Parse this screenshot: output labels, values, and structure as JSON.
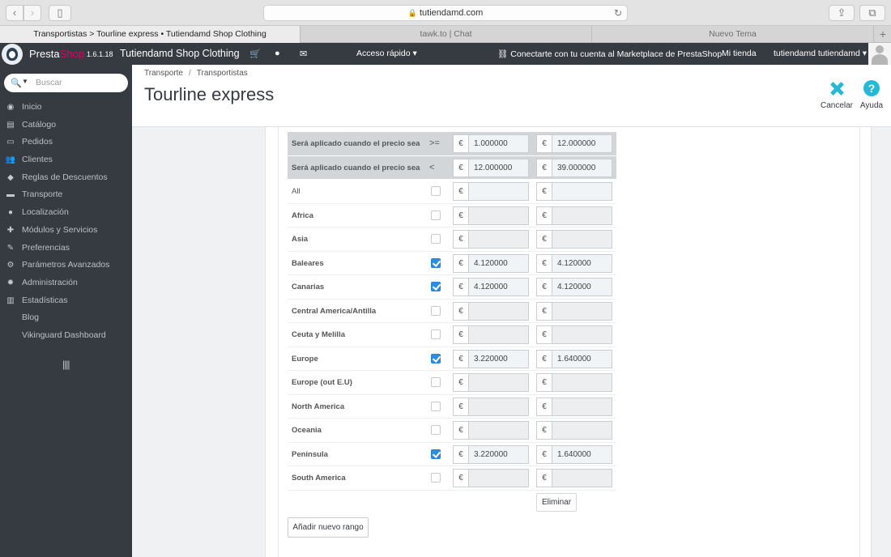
{
  "browser": {
    "url": "tutiendamd.com",
    "tabs": [
      {
        "label": "Transportistas > Tourline express • Tutiendamd Shop Clothing",
        "active": true
      },
      {
        "label": "tawk.to | Chat",
        "active": false
      },
      {
        "label": "Nuevo Tema",
        "active": false
      }
    ]
  },
  "header": {
    "brand_presta": "Presta",
    "brand_shop": "Shop",
    "version": "1.6.1.18",
    "shop_name": "Tutiendamd Shop Clothing",
    "quick_access": "Acceso rápido ▾",
    "marketplace": "Conectarte con tu cuenta al Marketplace de PrestaShop",
    "my_shop": "Mi tienda",
    "user": "tutiendamd tutiendamd ▾"
  },
  "sidebar": {
    "search_placeholder": "Buscar",
    "items": [
      {
        "label": "Inicio",
        "icon": "dashboard-icon",
        "glyph": "◉"
      },
      {
        "label": "Catálogo",
        "icon": "catalog-icon",
        "glyph": "▤"
      },
      {
        "label": "Pedidos",
        "icon": "orders-icon",
        "glyph": "▭"
      },
      {
        "label": "Clientes",
        "icon": "customers-icon",
        "glyph": "👥"
      },
      {
        "label": "Reglas de Descuentos",
        "icon": "tag-icon",
        "glyph": "◆"
      },
      {
        "label": "Transporte",
        "icon": "truck-icon",
        "glyph": "▬"
      },
      {
        "label": "Localización",
        "icon": "globe-icon",
        "glyph": "●"
      },
      {
        "label": "Módulos y Servicios",
        "icon": "puzzle-icon",
        "glyph": "✚"
      },
      {
        "label": "Preferencias",
        "icon": "wrench-icon",
        "glyph": "✎"
      },
      {
        "label": "Parámetros Avanzados",
        "icon": "cogs-icon",
        "glyph": "⚙"
      },
      {
        "label": "Administración",
        "icon": "cog-icon",
        "glyph": "✹"
      },
      {
        "label": "Estadísticas",
        "icon": "bar-chart-icon",
        "glyph": "▥"
      },
      {
        "label": "Blog",
        "icon": "",
        "glyph": ""
      },
      {
        "label": "Vikinguard Dashboard",
        "icon": "",
        "glyph": ""
      }
    ]
  },
  "page": {
    "breadcrumb": [
      "Transporte",
      "Transportistas"
    ],
    "title": "Tourline express",
    "cancel_label": "Cancelar",
    "help_label": "Ayuda"
  },
  "ranges": {
    "header_rows": [
      {
        "label": "Será aplicado cuando el precio sea",
        "operator": ">=",
        "from": "1.000000",
        "to": "12.000000"
      },
      {
        "label": "Será aplicado cuando el precio sea",
        "operator": "<",
        "from": "12.000000",
        "to": "39.000000"
      }
    ],
    "currency": "€",
    "zones": [
      {
        "name": "All",
        "checked": false,
        "v1": "",
        "v2": "",
        "plain": true
      },
      {
        "name": "Africa",
        "checked": false,
        "v1": "",
        "v2": ""
      },
      {
        "name": "Asia",
        "checked": false,
        "v1": "",
        "v2": ""
      },
      {
        "name": "Baleares",
        "checked": true,
        "v1": "4.120000",
        "v2": "4.120000"
      },
      {
        "name": "Canarias",
        "checked": true,
        "v1": "4.120000",
        "v2": "4.120000"
      },
      {
        "name": "Central America/Antilla",
        "checked": false,
        "v1": "",
        "v2": ""
      },
      {
        "name": "Ceuta y Melilla",
        "checked": false,
        "v1": "",
        "v2": ""
      },
      {
        "name": "Europe",
        "checked": true,
        "v1": "3.220000",
        "v2": "1.640000"
      },
      {
        "name": "Europe (out E.U)",
        "checked": false,
        "v1": "",
        "v2": ""
      },
      {
        "name": "North America",
        "checked": false,
        "v1": "",
        "v2": ""
      },
      {
        "name": "Oceania",
        "checked": false,
        "v1": "",
        "v2": ""
      },
      {
        "name": "Península",
        "checked": true,
        "v1": "3.220000",
        "v2": "1.640000"
      },
      {
        "name": "South America",
        "checked": false,
        "v1": "",
        "v2": ""
      }
    ],
    "delete_label": "Eliminar",
    "add_range_label": "Añadir nuevo rango"
  }
}
